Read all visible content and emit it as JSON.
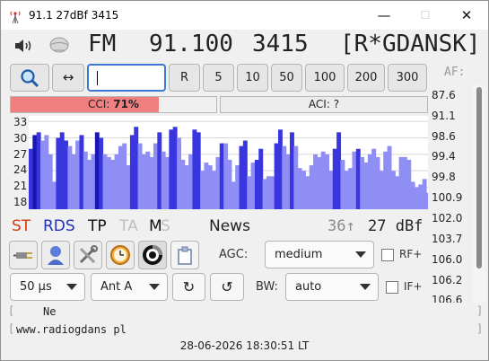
{
  "window": {
    "title": "91.1 27dBf 3415",
    "minimize": "—",
    "maximize": "☐",
    "close": "✕"
  },
  "header": {
    "band": "FM",
    "frequency": "91.100",
    "pi": "3415",
    "ps": "[R*GDANSK]",
    "af_label": "AF:"
  },
  "toolbar": {
    "swap": "↔",
    "freq_input": "",
    "buttons": [
      "R",
      "5",
      "10",
      "50",
      "100",
      "200",
      "300"
    ]
  },
  "meters": {
    "cci_label": "CCI:",
    "cci_value": "71%",
    "cci_fraction": 0.71,
    "aci_label": "ACI: ?"
  },
  "af_list": [
    "87.6",
    "91.1",
    "98.6",
    "99.4",
    "99.8",
    "100.9",
    "102.0",
    "103.7",
    "106.0",
    "106.2",
    "106.6"
  ],
  "chart_data": {
    "type": "bar",
    "title": "",
    "ylabel": "",
    "yticks": [
      "33",
      "30",
      "27",
      "24",
      "21",
      "18"
    ],
    "ylim": [
      17,
      34
    ],
    "x": [
      87.6,
      87.8,
      88.0,
      88.2,
      88.4,
      88.6,
      88.8,
      89.0,
      89.2,
      89.4,
      89.6,
      89.8,
      90.0,
      90.2,
      90.4,
      90.6,
      90.8,
      91.0,
      91.2,
      91.4,
      91.6,
      91.8,
      92.0,
      92.2,
      92.4,
      92.6,
      92.8,
      93.0,
      93.2,
      93.4,
      93.6,
      93.8,
      94.0,
      94.2,
      94.4,
      94.6,
      94.8,
      95.0,
      95.2,
      95.4,
      95.6,
      95.8,
      96.0,
      96.2,
      96.4,
      96.6,
      96.8,
      97.0,
      97.2,
      97.4,
      97.6,
      97.8,
      98.0,
      98.2,
      98.4,
      98.6,
      98.8,
      99.0,
      99.2,
      99.4,
      99.6,
      99.8,
      100.0,
      100.2,
      100.4,
      100.6,
      100.8,
      101.0,
      101.2,
      101.4,
      101.6,
      101.8,
      102.0,
      102.2,
      102.4,
      102.6,
      102.8,
      103.0,
      103.2,
      103.4,
      103.6,
      103.8,
      104.0,
      104.2,
      104.4,
      104.6,
      104.8,
      105.0,
      105.2,
      105.4,
      105.6,
      105.8,
      106.0,
      106.2,
      106.4,
      106.6,
      106.8,
      107.0,
      107.2,
      107.4,
      107.6,
      107.8,
      108.0
    ],
    "values": [
      28,
      30.5,
      31,
      29.5,
      30.5,
      27,
      22,
      30,
      31,
      29.5,
      28.5,
      27,
      29.5,
      30.5,
      27.5,
      26,
      27,
      31,
      30,
      27,
      26.5,
      26,
      27,
      28.5,
      29,
      25,
      30.5,
      32,
      29,
      27,
      27.5,
      26.5,
      29,
      31,
      27.5,
      26.5,
      31.5,
      32,
      30,
      26,
      25,
      27,
      31.5,
      31,
      24,
      25.5,
      25,
      24,
      26.5,
      29,
      29,
      26,
      22,
      25,
      28.5,
      29.5,
      23,
      25.5,
      26,
      28,
      22.5,
      23,
      23,
      29,
      31.5,
      28.5,
      27,
      31,
      28.5,
      24.5,
      24,
      23,
      25,
      27,
      26.5,
      27.5,
      27,
      24,
      28,
      31,
      26,
      24,
      24.5,
      27.5,
      28,
      26.5,
      25.5,
      27,
      28,
      26.5,
      24,
      27.5,
      28.5,
      24,
      23,
      26.5,
      26.5,
      26,
      22,
      21,
      21.5,
      22.5,
      20
    ],
    "highlight": [
      1,
      2,
      1,
      0,
      0,
      0,
      0,
      1,
      1,
      1,
      0,
      0,
      0,
      1,
      0,
      0,
      0,
      2,
      1,
      0,
      0,
      0,
      0,
      0,
      0,
      0,
      1,
      1,
      0,
      0,
      0,
      0,
      0,
      1,
      0,
      0,
      1,
      1,
      0,
      0,
      0,
      0,
      1,
      1,
      0,
      0,
      0,
      0,
      0,
      1,
      0,
      0,
      0,
      0,
      1,
      1,
      0,
      0,
      1,
      1,
      0,
      0,
      0,
      1,
      1,
      0,
      0,
      1,
      0,
      0,
      0,
      0,
      0,
      0,
      0,
      0,
      0,
      0,
      1,
      1,
      0,
      0,
      0,
      0,
      1,
      0,
      0,
      0,
      0,
      0,
      0,
      0,
      0,
      0,
      0,
      0,
      0,
      0,
      0,
      0,
      0,
      0,
      0
    ],
    "colors": {
      "base": "#8e8ef5",
      "peak": "#3a36df",
      "current": "#1818b0",
      "background": "#ffffff"
    }
  },
  "rds_flags": {
    "st": "ST",
    "rds": "RDS",
    "tp": "TP",
    "ta": "TA",
    "m": "M",
    "s": "S",
    "pty": "News",
    "signal_extra": "36↑",
    "signal": "27 dBf"
  },
  "flag_colors": {
    "st": "#d83810",
    "rds": "#2430b8",
    "active": "#111111",
    "inactive": "#c0c0c0"
  },
  "controls": {
    "agc_label": "AGC:",
    "agc_value": "medium",
    "rf_label": "RF+",
    "deemphasis_value": "50 µs",
    "antenna_value": "Ant A",
    "bw_label": "BW:",
    "bw_value": "auto",
    "if_label": "IF+"
  },
  "rds_text": {
    "group_line": "Ne",
    "radiotext": "www.radiogdans  pl",
    "bracket_l": "[",
    "bracket_r": "]"
  },
  "status": {
    "datetime": "28-06-2026 18:30:51 LT"
  }
}
